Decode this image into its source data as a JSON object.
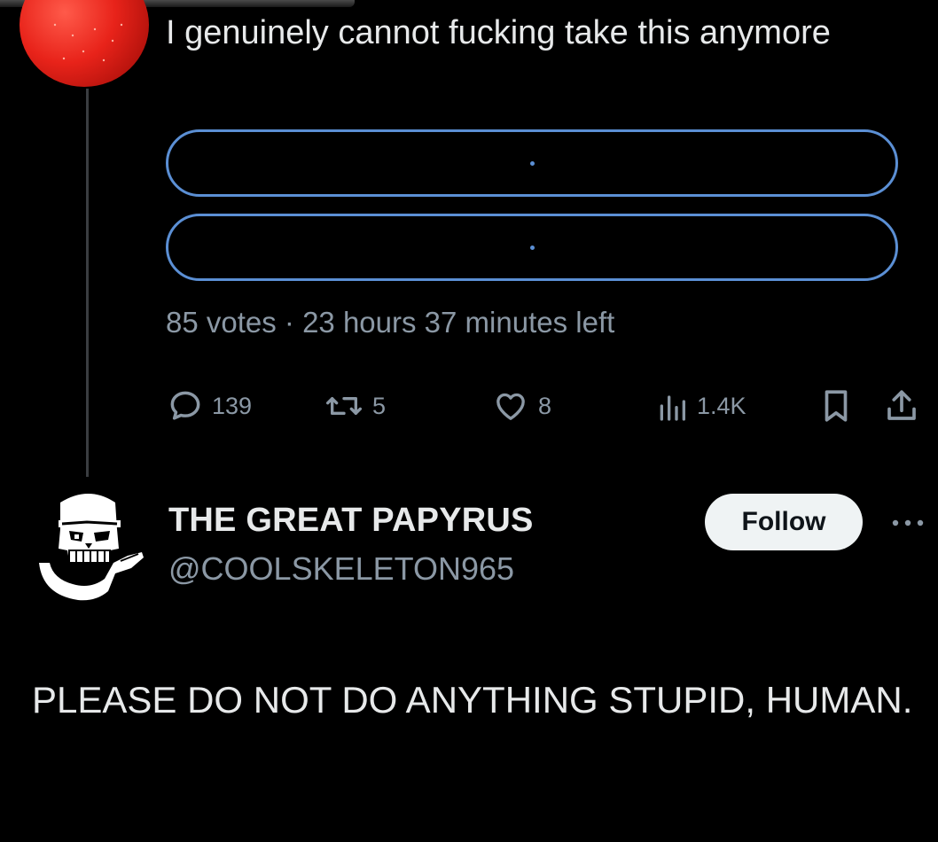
{
  "tweet": {
    "text": "I genuinely cannot fucking take this anymore",
    "poll": {
      "options": [
        ".",
        "."
      ],
      "meta": "85 votes · 23 hours 37 minutes left"
    },
    "actions": {
      "replies": "139",
      "retweets": "5",
      "likes": "8",
      "views": "1.4K"
    }
  },
  "reply": {
    "display_name": "THE GREAT PAPYRUS",
    "handle": "@COOLSKELETON965",
    "follow_label": "Follow",
    "text": "PLEASE DO NOT DO ANYTHING STUPID, HUMAN."
  },
  "colors": {
    "background": "#000000",
    "text": "#e7e9ea",
    "secondary": "#8b98a5",
    "poll_border": "#5b8fd4",
    "follow_bg": "#eff3f4"
  },
  "icons": {
    "reply": "speech-bubble-icon",
    "retweet": "retweet-icon",
    "like": "heart-icon",
    "views": "bar-chart-icon",
    "bookmark": "bookmark-icon",
    "share": "share-icon",
    "more": "more-dots-icon"
  }
}
